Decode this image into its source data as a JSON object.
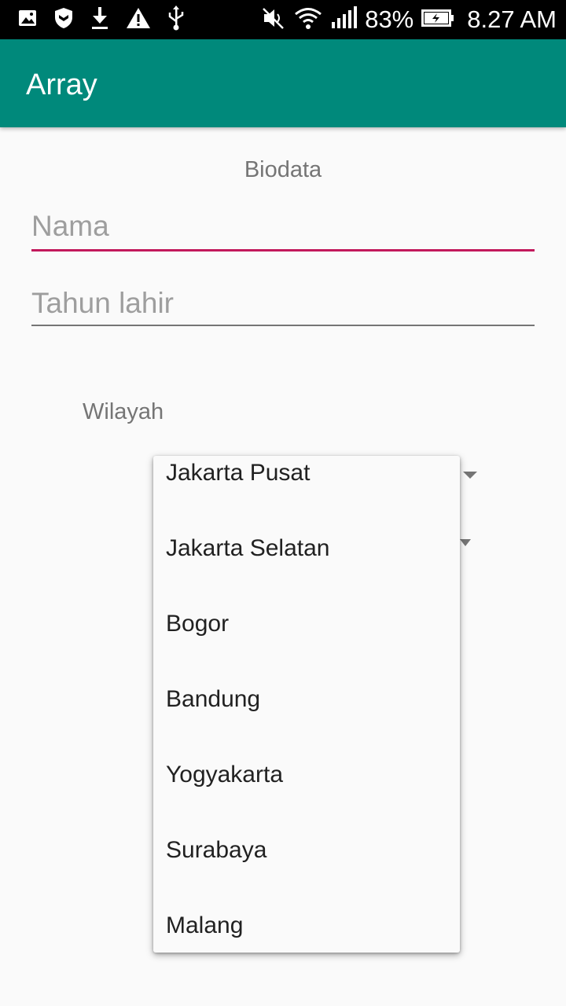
{
  "status_bar": {
    "left_icons": [
      "image-icon",
      "shield-icon",
      "download-icon",
      "warning-icon",
      "usb-icon"
    ],
    "right_icons": [
      "mute-icon",
      "wifi-icon",
      "signal-icon",
      "battery-charging-icon"
    ],
    "battery": "83%",
    "time": "8.27 AM"
  },
  "app_bar": {
    "title": "Array"
  },
  "form": {
    "heading": "Biodata",
    "name_placeholder": "Nama",
    "year_placeholder": "Tahun lahir",
    "region_label": "Wilayah"
  },
  "dropdown": {
    "items": [
      "Jakarta Pusat",
      "Jakarta Selatan",
      "Bogor",
      "Bandung",
      "Yogyakarta",
      "Surabaya",
      "Malang"
    ]
  },
  "colors": {
    "app_bar": "#00897b",
    "focused_underline": "#c2185b",
    "status_bar": "#000000"
  }
}
